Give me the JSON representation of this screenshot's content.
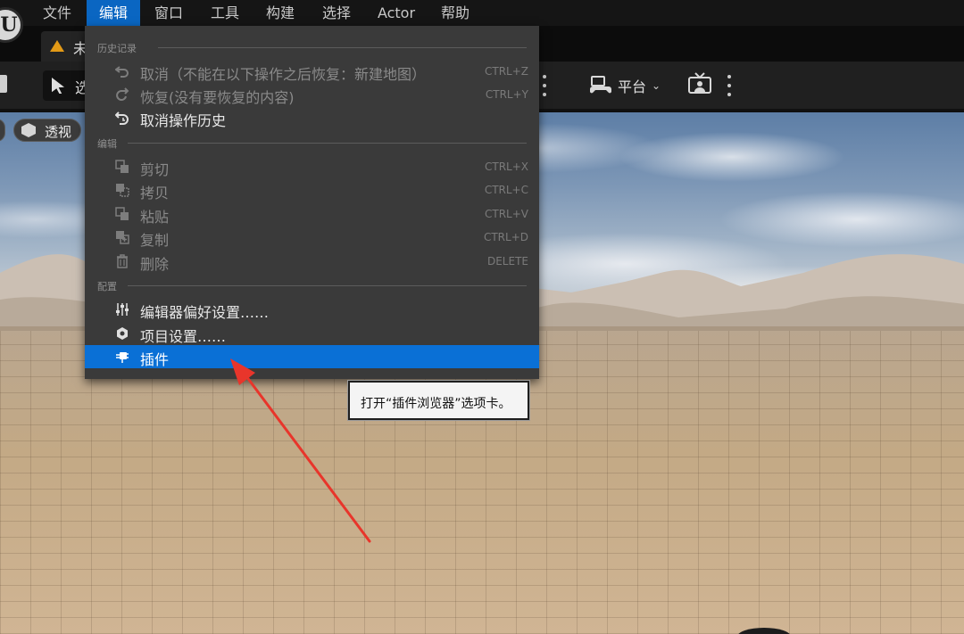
{
  "menubar": {
    "items": [
      "文件",
      "编辑",
      "窗口",
      "工具",
      "构建",
      "选择",
      "Actor",
      "帮助"
    ],
    "active_index": 1
  },
  "tab": {
    "title_visible": "未"
  },
  "toolbar": {
    "select_mode_label": "选",
    "platform_label": "平台"
  },
  "viewport": {
    "perspective_label": "透视"
  },
  "dropdown": {
    "sections": [
      {
        "label": "历史记录",
        "items": [
          {
            "label": "取消（不能在以下操作之后恢复：新建地图）",
            "shortcut": "CTRL+Z",
            "icon": "undo-icon",
            "disabled": true
          },
          {
            "label": "恢复(没有要恢复的内容)",
            "shortcut": "CTRL+Y",
            "icon": "redo-icon",
            "disabled": true
          },
          {
            "label": "取消操作历史",
            "shortcut": "",
            "icon": "undo-history-icon",
            "disabled": false
          }
        ]
      },
      {
        "label": "编辑",
        "items": [
          {
            "label": "剪切",
            "shortcut": "CTRL+X",
            "icon": "cut-icon",
            "disabled": true
          },
          {
            "label": "拷贝",
            "shortcut": "CTRL+C",
            "icon": "copy-icon",
            "disabled": true
          },
          {
            "label": "粘贴",
            "shortcut": "CTRL+V",
            "icon": "paste-icon",
            "disabled": true
          },
          {
            "label": "复制",
            "shortcut": "CTRL+D",
            "icon": "duplicate-icon",
            "disabled": true
          },
          {
            "label": "删除",
            "shortcut": "DELETE",
            "icon": "delete-icon",
            "disabled": true
          }
        ]
      },
      {
        "label": "配置",
        "items": [
          {
            "label": "编辑器偏好设置……",
            "shortcut": "",
            "icon": "editor-preferences-icon",
            "disabled": false
          },
          {
            "label": "项目设置……",
            "shortcut": "",
            "icon": "project-settings-icon",
            "disabled": false
          },
          {
            "label": "插件",
            "shortcut": "",
            "icon": "plugins-icon",
            "disabled": false,
            "highlighted": true
          }
        ]
      }
    ]
  },
  "tooltip": {
    "text": "打开“插件浏览器”选项卡。"
  },
  "colors": {
    "menu_active_bg": "#0a66c2",
    "menu_highlight_bg": "#0a70d6",
    "dropdown_bg": "#3a3a3a",
    "annotation_arrow": "#e8352b",
    "tab_icon": "#e39a16"
  }
}
